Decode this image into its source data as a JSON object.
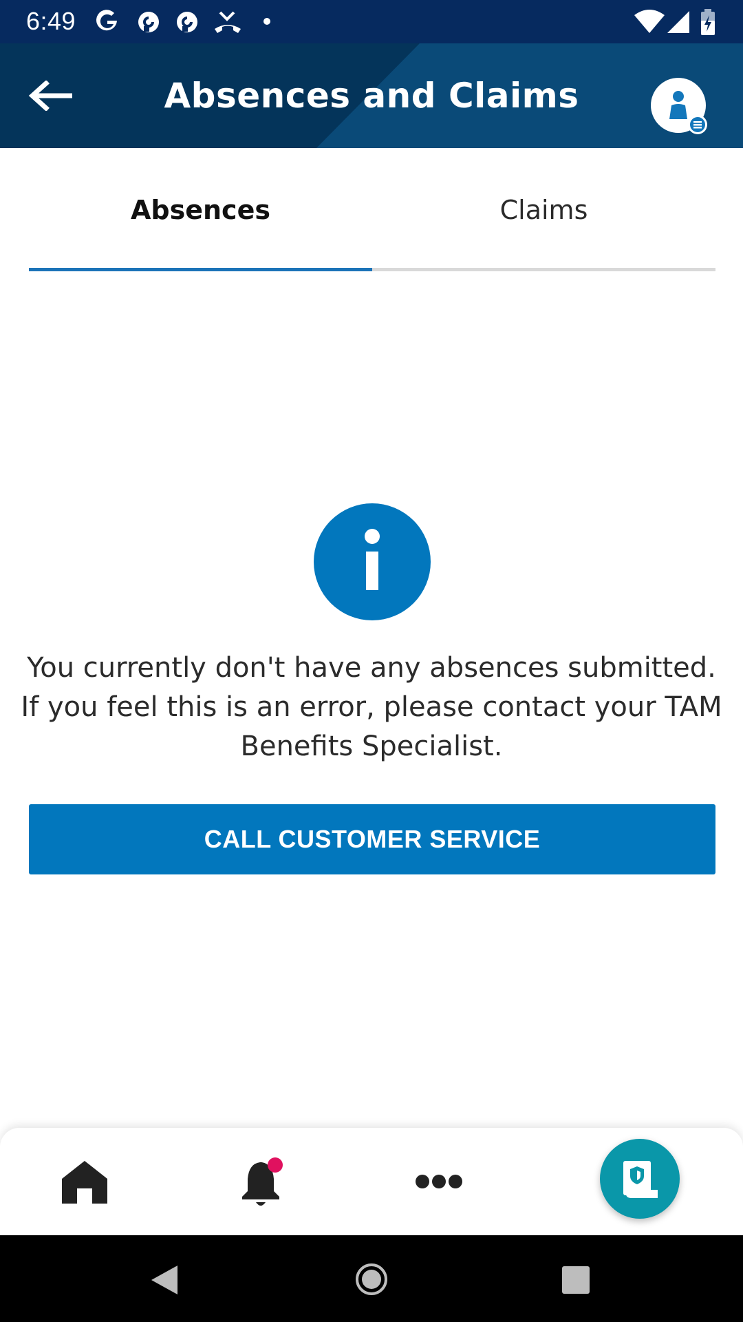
{
  "status_bar": {
    "time": "6:49",
    "notification_icons": [
      "google-icon",
      "pocket-casts-icon",
      "pocket-casts-icon",
      "missed-call-icon",
      "dot-icon"
    ],
    "system_icons": [
      "wifi-icon",
      "signal-icon",
      "battery-icon"
    ]
  },
  "app_bar": {
    "title": "Absences and Claims",
    "back_icon": "back-arrow-icon",
    "profile_icon": "profile-icon",
    "background_color": "#053a64"
  },
  "tabs": {
    "items": [
      {
        "label": "Absences",
        "selected": true
      },
      {
        "label": "Claims",
        "selected": false
      }
    ],
    "indicator_color": "#1b73b8"
  },
  "empty_state": {
    "icon": "info-icon",
    "message": "You currently don't have any absences submitted. If you feel this is an error, please contact your TAM Benefits Specialist.",
    "button_label": "CALL CUSTOMER SERVICE",
    "button_color": "#0277bd"
  },
  "bottom_nav": {
    "items": [
      {
        "icon": "home-icon"
      },
      {
        "icon": "bell-icon",
        "badge": true,
        "badge_color": "#e0115f"
      },
      {
        "icon": "more-icon"
      }
    ],
    "fab_icon": "claim-document-icon",
    "fab_color": "#0a97a9"
  },
  "system_nav": {
    "buttons": [
      "back-triangle-icon",
      "home-circle-icon",
      "recents-square-icon"
    ]
  }
}
